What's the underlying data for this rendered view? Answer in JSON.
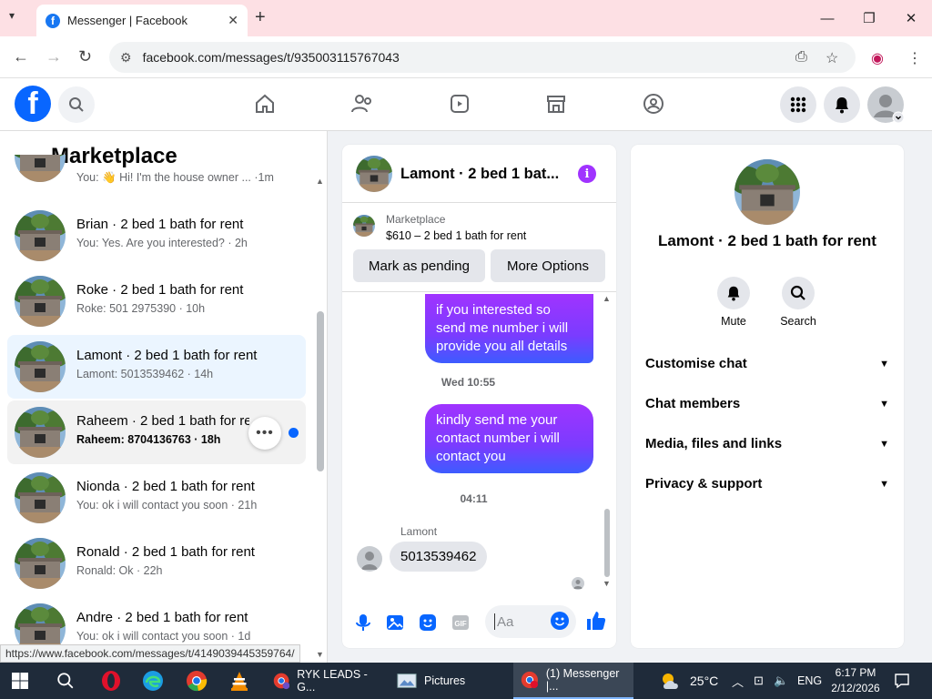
{
  "browser": {
    "tab_title": "Messenger | Facebook",
    "tab_favicon": "f",
    "tab_close": "✕",
    "new_tab": "+",
    "url": "facebook.com/messages/t/935003115767043",
    "status_url": "https://www.facebook.com/messages/t/4149039445359764/"
  },
  "sidebar": {
    "title": "Marketplace",
    "back_glyph": "←",
    "conversations": [
      {
        "name": "",
        "last": "You: 👋 Hi! I'm the house owner ... ·1m",
        "state": "normal"
      },
      {
        "name": "Brian · 2 bed 1 bath for rent",
        "last": "You: Yes. Are you interested? · 2h",
        "state": "normal"
      },
      {
        "name": "Roke · 2 bed 1 bath for rent",
        "last": "Roke: 501 2975390 · 10h",
        "state": "normal"
      },
      {
        "name": "Lamont · 2 bed 1 bath for rent",
        "last": "Lamont: 5013539462 · 14h",
        "state": "active"
      },
      {
        "name": "Raheem · 2 bed 1 bath for rent",
        "last": "Raheem: 8704136763 · 18h",
        "state": "unread"
      },
      {
        "name": "Nionda · 2 bed 1 bath for rent",
        "last": "You: ok i will contact you soon · 21h",
        "state": "normal"
      },
      {
        "name": "Ronald · 2 bed 1 bath for rent",
        "last": "Ronald: Ok · 22h",
        "state": "normal"
      },
      {
        "name": "Andre · 2 bed 1 bath for rent",
        "last": "You: ok i will contact you soon · 1d",
        "state": "normal"
      }
    ]
  },
  "chat": {
    "title": "Lamont · 2 bed 1 bat...",
    "info_glyph": "i",
    "marketplace_label": "Marketplace",
    "listing": "$610 – 2 bed 1 bath for rent",
    "mark_pending": "Mark as pending",
    "more_options": "More Options",
    "messages": [
      {
        "dir": "out",
        "text": "if you interested so send me number i will provide you all details"
      },
      {
        "dir": "time",
        "text": "Wed 10:55"
      },
      {
        "dir": "out",
        "text": "kindly send me your contact number i will contact you"
      },
      {
        "dir": "time",
        "text": "04:11"
      },
      {
        "dir": "in",
        "sender": "Lamont",
        "text": "5013539462"
      }
    ],
    "composer_placeholder": "Aa"
  },
  "details": {
    "title": "Lamont · 2 bed 1 bath for rent",
    "mute": "Mute",
    "search": "Search",
    "sections": [
      "Customise chat",
      "Chat members",
      "Media, files and links",
      "Privacy & support"
    ]
  },
  "taskbar": {
    "apps": [
      {
        "label": "RYK LEADS - G...",
        "icon": "chrome-icon"
      },
      {
        "label": "Pictures",
        "icon": "pictures-icon"
      },
      {
        "label": "(1) Messenger |...",
        "icon": "chrome-icon"
      }
    ],
    "temperature": "25°C",
    "lang": "ENG",
    "time": "6:17 PM",
    "date": "2/12/2026"
  },
  "colors": {
    "fb_blue": "#0866ff",
    "bubble_purple": "#a033ff",
    "bubble_blue": "#3d5cff",
    "active_row": "#ebf5ff",
    "tabstrip": "#fde0e4"
  }
}
